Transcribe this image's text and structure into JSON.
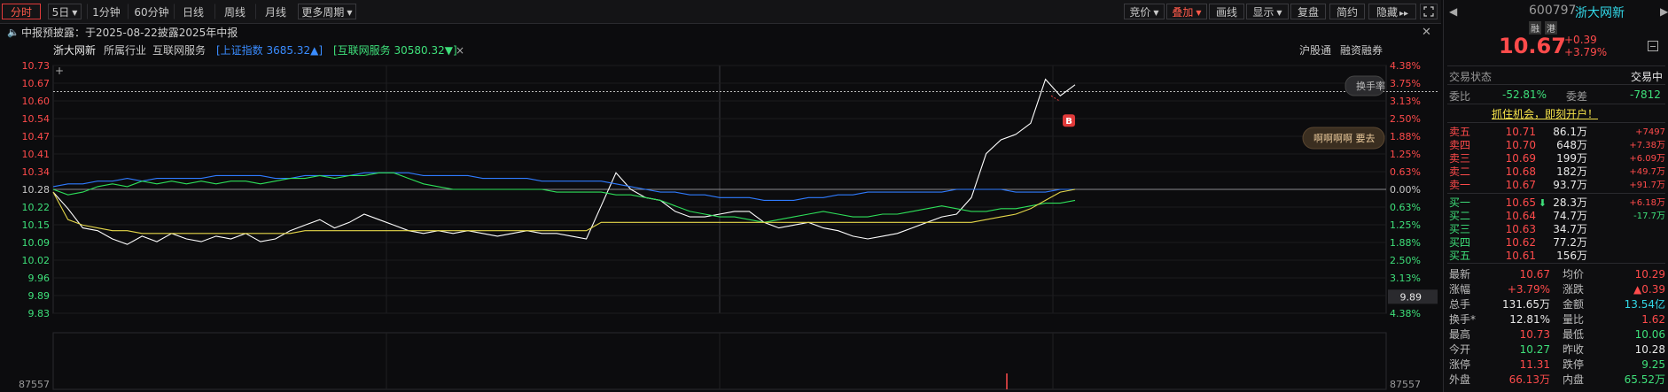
{
  "toolbar": {
    "periods": [
      "分时",
      "5日",
      "1分钟",
      "60分钟",
      "日线",
      "周线",
      "月线",
      "更多周期"
    ],
    "right_buttons": [
      "竞价",
      "叠加",
      "画线",
      "显示",
      "复盘",
      "简约",
      "隐藏"
    ],
    "expand_icon": "expand-icon"
  },
  "notice": {
    "text": "中报预披露：于2025-08-22披露2025年中报"
  },
  "infobar": {
    "stock": "浙大网新",
    "industry": "所属行业",
    "sector": "互联网服务",
    "index1": "[上证指数 3685.32▲]",
    "index2": "[互联网服务 30580.32▼]",
    "x": "×",
    "right1": "沪股通",
    "right2": "融资融券"
  },
  "chart_data": {
    "type": "line",
    "prev_close": 10.28,
    "y_left": [
      "10.73",
      "10.67",
      "10.60",
      "10.54",
      "10.47",
      "10.41",
      "10.34",
      "10.28",
      "10.22",
      "10.15",
      "10.09",
      "10.02",
      "9.96",
      "9.89",
      "9.83"
    ],
    "y_right": [
      "4.38%",
      "3.75%",
      "3.13%",
      "2.50%",
      "1.88%",
      "1.25%",
      "0.63%",
      "0.00%",
      "0.63%",
      "1.25%",
      "1.88%",
      "2.50%",
      "3.13%",
      "3.75%",
      "4.38%"
    ],
    "volume_label": "87557",
    "cursor_value": "9.89",
    "float_labels": [
      "换手率",
      "啊啊啊啊 要去"
    ],
    "b_marker": "B",
    "ylim": [
      9.83,
      10.73
    ],
    "series": [
      {
        "color": "#ffffff",
        "values": [
          10.27,
          10.21,
          10.14,
          10.13,
          10.1,
          10.08,
          10.11,
          10.09,
          10.12,
          10.1,
          10.09,
          10.11,
          10.1,
          10.12,
          10.09,
          10.1,
          10.13,
          10.15,
          10.17,
          10.14,
          10.16,
          10.19,
          10.17,
          10.15,
          10.13,
          10.12,
          10.13,
          10.12,
          10.13,
          10.12,
          10.11,
          10.12,
          10.13,
          10.12,
          10.12,
          10.11,
          10.1,
          10.22,
          10.34,
          10.28,
          10.25,
          10.24,
          10.2,
          10.18,
          10.18,
          10.19,
          10.2,
          10.2,
          10.16,
          10.14,
          10.15,
          10.16,
          10.14,
          10.13,
          10.11,
          10.1,
          10.11,
          10.12,
          10.14,
          10.16,
          10.18,
          10.19,
          10.25,
          10.41,
          10.46,
          10.48,
          10.52,
          10.68,
          10.62,
          10.66
        ]
      },
      {
        "color": "#2f7bff",
        "values": [
          10.29,
          10.3,
          10.3,
          10.31,
          10.31,
          10.32,
          10.31,
          10.32,
          10.32,
          10.32,
          10.32,
          10.33,
          10.33,
          10.33,
          10.33,
          10.32,
          10.32,
          10.33,
          10.33,
          10.33,
          10.33,
          10.34,
          10.34,
          10.34,
          10.34,
          10.33,
          10.33,
          10.33,
          10.33,
          10.32,
          10.32,
          10.32,
          10.32,
          10.31,
          10.31,
          10.31,
          10.31,
          10.31,
          10.3,
          10.29,
          10.28,
          10.27,
          10.27,
          10.26,
          10.26,
          10.25,
          10.25,
          10.25,
          10.24,
          10.24,
          10.24,
          10.25,
          10.25,
          10.26,
          10.26,
          10.27,
          10.27,
          10.27,
          10.27,
          10.27,
          10.27,
          10.28,
          10.28,
          10.28,
          10.28,
          10.27,
          10.27,
          10.27,
          10.28,
          10.28
        ]
      },
      {
        "color": "#2ee05a",
        "values": [
          10.28,
          10.26,
          10.27,
          10.29,
          10.3,
          10.29,
          10.31,
          10.3,
          10.31,
          10.3,
          10.31,
          10.3,
          10.31,
          10.31,
          10.3,
          10.31,
          10.32,
          10.32,
          10.33,
          10.32,
          10.33,
          10.33,
          10.34,
          10.34,
          10.32,
          10.3,
          10.29,
          10.28,
          10.28,
          10.28,
          10.28,
          10.28,
          10.28,
          10.28,
          10.27,
          10.27,
          10.27,
          10.27,
          10.26,
          10.26,
          10.25,
          10.24,
          10.22,
          10.2,
          10.19,
          10.18,
          10.18,
          10.17,
          10.16,
          10.17,
          10.18,
          10.19,
          10.2,
          10.19,
          10.18,
          10.18,
          10.19,
          10.19,
          10.2,
          10.21,
          10.22,
          10.21,
          10.2,
          10.2,
          10.21,
          10.21,
          10.22,
          10.23,
          10.23,
          10.24
        ]
      },
      {
        "color": "#e6d84a",
        "values": [
          10.27,
          10.17,
          10.15,
          10.14,
          10.13,
          10.13,
          10.12,
          10.12,
          10.12,
          10.12,
          10.12,
          10.12,
          10.12,
          10.12,
          10.12,
          10.12,
          10.12,
          10.13,
          10.13,
          10.13,
          10.13,
          10.13,
          10.13,
          10.13,
          10.13,
          10.13,
          10.13,
          10.13,
          10.13,
          10.13,
          10.13,
          10.13,
          10.13,
          10.13,
          10.13,
          10.13,
          10.13,
          10.16,
          10.16,
          10.16,
          10.16,
          10.16,
          10.16,
          10.16,
          10.16,
          10.16,
          10.16,
          10.16,
          10.16,
          10.16,
          10.16,
          10.16,
          10.16,
          10.16,
          10.16,
          10.16,
          10.16,
          10.16,
          10.16,
          10.16,
          10.16,
          10.16,
          10.16,
          10.17,
          10.18,
          10.19,
          10.21,
          10.24,
          10.27,
          10.28
        ]
      }
    ]
  },
  "right_panel": {
    "code": "600797",
    "name": "浙大网新",
    "tags": [
      "融",
      "港"
    ],
    "price": "10.67",
    "change": "+0.39",
    "change_pct": "+3.79%",
    "trade_status_label": "交易状态",
    "trade_status": "交易中",
    "weibi_label": "委比",
    "weibi": "-52.81%",
    "weicha_label": "委差",
    "weicha": "-7812",
    "promo": "抓住机会，即刻开户！",
    "sell": [
      {
        "label": "卖五",
        "price": "10.71",
        "vol": "86.1万",
        "chg": "+7497"
      },
      {
        "label": "卖四",
        "price": "10.70",
        "vol": "648万",
        "chg": "+7.38万"
      },
      {
        "label": "卖三",
        "price": "10.69",
        "vol": "199万",
        "chg": "+6.09万"
      },
      {
        "label": "卖二",
        "price": "10.68",
        "vol": "182万",
        "chg": "+49.7万"
      },
      {
        "label": "卖一",
        "price": "10.67",
        "vol": "93.7万",
        "chg": "+91.7万"
      }
    ],
    "buy": [
      {
        "label": "买一",
        "price": "10.65",
        "vol": "28.3万",
        "chg": "+6.18万"
      },
      {
        "label": "买二",
        "price": "10.64",
        "vol": "74.7万",
        "chg": "-17.7万"
      },
      {
        "label": "买三",
        "price": "10.63",
        "vol": "34.7万",
        "chg": ""
      },
      {
        "label": "买四",
        "price": "10.62",
        "vol": "77.2万",
        "chg": ""
      },
      {
        "label": "买五",
        "price": "10.61",
        "vol": "156万",
        "chg": ""
      }
    ],
    "stats": [
      {
        "l1": "最新",
        "v1": "10.67",
        "c1": "red",
        "l2": "均价",
        "v2": "10.29",
        "c2": "red"
      },
      {
        "l1": "涨幅",
        "v1": "+3.79%",
        "c1": "red",
        "l2": "涨跌",
        "v2": "▲0.39",
        "c2": "red"
      },
      {
        "l1": "总手",
        "v1": "131.65万",
        "c1": "white",
        "l2": "金额",
        "v2": "13.54亿",
        "c2": "cyan"
      },
      {
        "l1": "换手*",
        "v1": "12.81%",
        "c1": "white",
        "l2": "量比",
        "v2": "1.62",
        "c2": "red"
      },
      {
        "l1": "最高",
        "v1": "10.73",
        "c1": "red",
        "l2": "最低",
        "v2": "10.06",
        "c2": "green"
      },
      {
        "l1": "今开",
        "v1": "10.27",
        "c1": "green",
        "l2": "昨收",
        "v2": "10.28",
        "c2": "white"
      },
      {
        "l1": "涨停",
        "v1": "11.31",
        "c1": "red",
        "l2": "跌停",
        "v2": "9.25",
        "c2": "green"
      },
      {
        "l1": "外盘",
        "v1": "66.13万",
        "c1": "red",
        "l2": "内盘",
        "v2": "65.52万",
        "c2": "green"
      }
    ]
  }
}
